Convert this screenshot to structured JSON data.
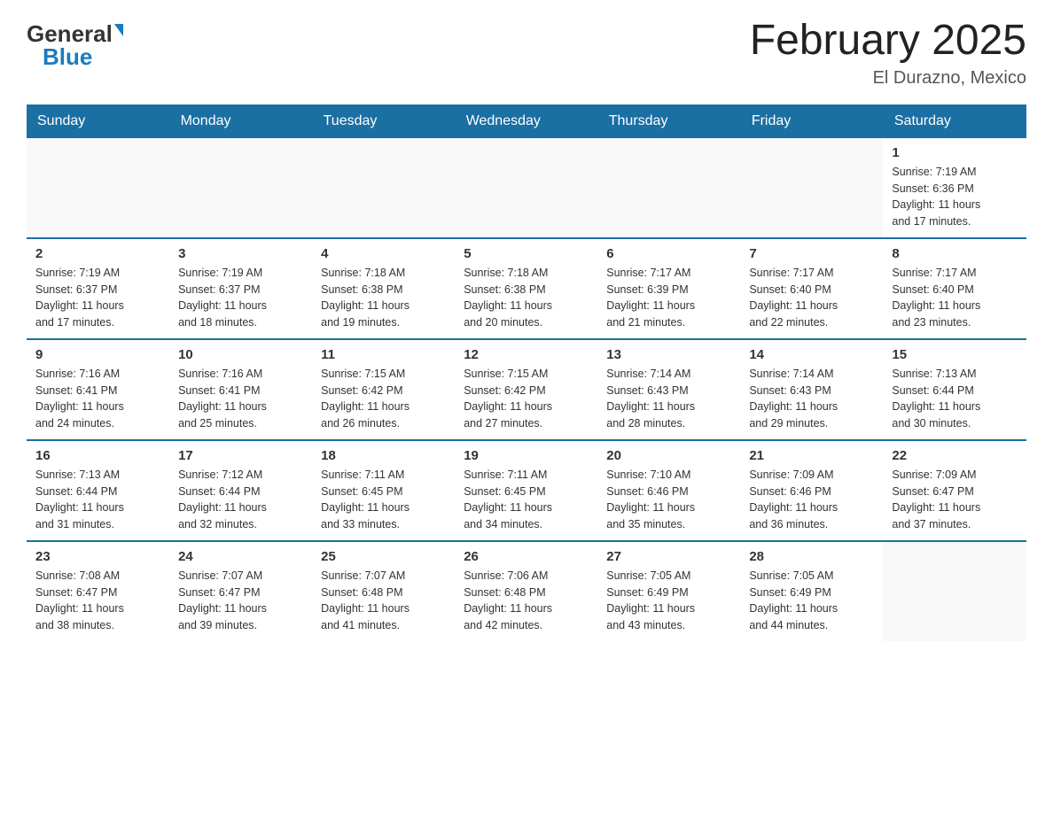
{
  "logo": {
    "general": "General",
    "blue": "Blue"
  },
  "title": "February 2025",
  "location": "El Durazno, Mexico",
  "days_of_week": [
    "Sunday",
    "Monday",
    "Tuesday",
    "Wednesday",
    "Thursday",
    "Friday",
    "Saturday"
  ],
  "weeks": [
    [
      {
        "day": "",
        "info": ""
      },
      {
        "day": "",
        "info": ""
      },
      {
        "day": "",
        "info": ""
      },
      {
        "day": "",
        "info": ""
      },
      {
        "day": "",
        "info": ""
      },
      {
        "day": "",
        "info": ""
      },
      {
        "day": "1",
        "info": "Sunrise: 7:19 AM\nSunset: 6:36 PM\nDaylight: 11 hours\nand 17 minutes."
      }
    ],
    [
      {
        "day": "2",
        "info": "Sunrise: 7:19 AM\nSunset: 6:37 PM\nDaylight: 11 hours\nand 17 minutes."
      },
      {
        "day": "3",
        "info": "Sunrise: 7:19 AM\nSunset: 6:37 PM\nDaylight: 11 hours\nand 18 minutes."
      },
      {
        "day": "4",
        "info": "Sunrise: 7:18 AM\nSunset: 6:38 PM\nDaylight: 11 hours\nand 19 minutes."
      },
      {
        "day": "5",
        "info": "Sunrise: 7:18 AM\nSunset: 6:38 PM\nDaylight: 11 hours\nand 20 minutes."
      },
      {
        "day": "6",
        "info": "Sunrise: 7:17 AM\nSunset: 6:39 PM\nDaylight: 11 hours\nand 21 minutes."
      },
      {
        "day": "7",
        "info": "Sunrise: 7:17 AM\nSunset: 6:40 PM\nDaylight: 11 hours\nand 22 minutes."
      },
      {
        "day": "8",
        "info": "Sunrise: 7:17 AM\nSunset: 6:40 PM\nDaylight: 11 hours\nand 23 minutes."
      }
    ],
    [
      {
        "day": "9",
        "info": "Sunrise: 7:16 AM\nSunset: 6:41 PM\nDaylight: 11 hours\nand 24 minutes."
      },
      {
        "day": "10",
        "info": "Sunrise: 7:16 AM\nSunset: 6:41 PM\nDaylight: 11 hours\nand 25 minutes."
      },
      {
        "day": "11",
        "info": "Sunrise: 7:15 AM\nSunset: 6:42 PM\nDaylight: 11 hours\nand 26 minutes."
      },
      {
        "day": "12",
        "info": "Sunrise: 7:15 AM\nSunset: 6:42 PM\nDaylight: 11 hours\nand 27 minutes."
      },
      {
        "day": "13",
        "info": "Sunrise: 7:14 AM\nSunset: 6:43 PM\nDaylight: 11 hours\nand 28 minutes."
      },
      {
        "day": "14",
        "info": "Sunrise: 7:14 AM\nSunset: 6:43 PM\nDaylight: 11 hours\nand 29 minutes."
      },
      {
        "day": "15",
        "info": "Sunrise: 7:13 AM\nSunset: 6:44 PM\nDaylight: 11 hours\nand 30 minutes."
      }
    ],
    [
      {
        "day": "16",
        "info": "Sunrise: 7:13 AM\nSunset: 6:44 PM\nDaylight: 11 hours\nand 31 minutes."
      },
      {
        "day": "17",
        "info": "Sunrise: 7:12 AM\nSunset: 6:44 PM\nDaylight: 11 hours\nand 32 minutes."
      },
      {
        "day": "18",
        "info": "Sunrise: 7:11 AM\nSunset: 6:45 PM\nDaylight: 11 hours\nand 33 minutes."
      },
      {
        "day": "19",
        "info": "Sunrise: 7:11 AM\nSunset: 6:45 PM\nDaylight: 11 hours\nand 34 minutes."
      },
      {
        "day": "20",
        "info": "Sunrise: 7:10 AM\nSunset: 6:46 PM\nDaylight: 11 hours\nand 35 minutes."
      },
      {
        "day": "21",
        "info": "Sunrise: 7:09 AM\nSunset: 6:46 PM\nDaylight: 11 hours\nand 36 minutes."
      },
      {
        "day": "22",
        "info": "Sunrise: 7:09 AM\nSunset: 6:47 PM\nDaylight: 11 hours\nand 37 minutes."
      }
    ],
    [
      {
        "day": "23",
        "info": "Sunrise: 7:08 AM\nSunset: 6:47 PM\nDaylight: 11 hours\nand 38 minutes."
      },
      {
        "day": "24",
        "info": "Sunrise: 7:07 AM\nSunset: 6:47 PM\nDaylight: 11 hours\nand 39 minutes."
      },
      {
        "day": "25",
        "info": "Sunrise: 7:07 AM\nSunset: 6:48 PM\nDaylight: 11 hours\nand 41 minutes."
      },
      {
        "day": "26",
        "info": "Sunrise: 7:06 AM\nSunset: 6:48 PM\nDaylight: 11 hours\nand 42 minutes."
      },
      {
        "day": "27",
        "info": "Sunrise: 7:05 AM\nSunset: 6:49 PM\nDaylight: 11 hours\nand 43 minutes."
      },
      {
        "day": "28",
        "info": "Sunrise: 7:05 AM\nSunset: 6:49 PM\nDaylight: 11 hours\nand 44 minutes."
      },
      {
        "day": "",
        "info": ""
      }
    ]
  ]
}
